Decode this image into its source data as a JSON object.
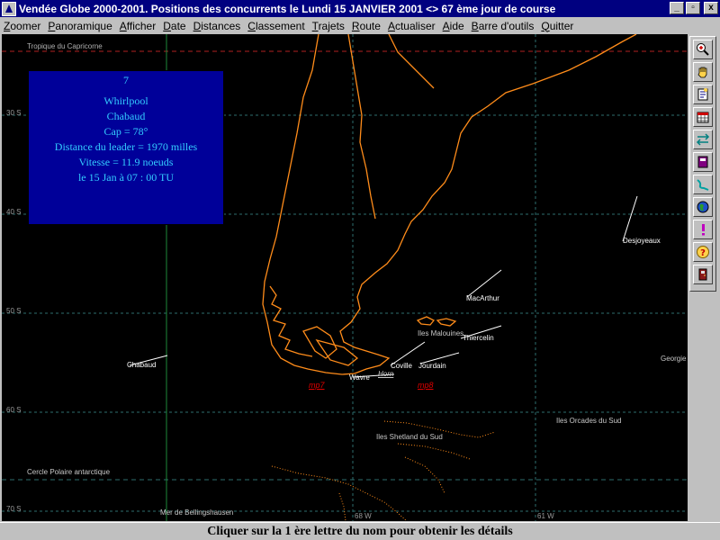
{
  "window": {
    "title": "Vendée Globe 2000-2001. Positions des concurrents le Lundi 15 JANVIER   2001 <> 67 ème jour de course",
    "minimize": "_",
    "maximize": "▫",
    "close": "x"
  },
  "menu": [
    {
      "ul": "Z",
      "rest": "oomer"
    },
    {
      "ul": "P",
      "rest": "anoramique"
    },
    {
      "ul": "A",
      "rest": "fficher"
    },
    {
      "ul": "D",
      "rest": "ate"
    },
    {
      "ul": "D",
      "rest": "istances"
    },
    {
      "ul": "C",
      "rest": "lassement"
    },
    {
      "ul": "T",
      "rest": "rajets"
    },
    {
      "ul": "R",
      "rest": "oute"
    },
    {
      "ul": "A",
      "rest": "ctualiser"
    },
    {
      "ul": "A",
      "rest": "ide"
    },
    {
      "ul": "B",
      "rest": "arre d'outils"
    },
    {
      "ul": "Q",
      "rest": "uitter"
    }
  ],
  "map": {
    "lat_labels": [
      "30 S",
      "40 S",
      "50 S",
      "60 S",
      "70 S"
    ],
    "lon_labels": [
      "68 W",
      "61 W"
    ],
    "places": {
      "tropique": "Tropique du Capricorne",
      "cercle_polaire": "Cercle Polaire antarctique",
      "malouines": "Iles Malouines",
      "georgie": "Georgie du Sud",
      "orcades": "Iles Orcades du Sud",
      "shetland": "Iles Shetland du Sud",
      "bellingshausen": "Mer de Bellingshausen",
      "horn": "Horn"
    },
    "racers": {
      "desjoyeaux": "Desjoyeaux",
      "macarthur": "MacArthur",
      "thiercelin": "Thiercelin",
      "chabaud": "Chabaud",
      "coville": "Coville",
      "jourdain": "Jourdain",
      "wavre": "Wavre"
    },
    "mp_markers": [
      "mp7",
      "mp8"
    ]
  },
  "info_box": {
    "rank": "7",
    "boat": "Whirlpool",
    "skipper": "Chabaud",
    "cap": "Cap =  78°",
    "distance": "Distance du leader = 1970 milles",
    "vitesse": "Vitesse =  11.9 noeuds",
    "date": "le 15 Jan à 07 : 00 TU"
  },
  "toolbar_tools": [
    "zoom-icon",
    "hand-pan-icon",
    "document-icon",
    "calendar-icon",
    "ruler-arrows-icon",
    "notebook-icon",
    "route-icon",
    "globe-icon",
    "exclamation-icon",
    "help-icon",
    "exit-door-icon"
  ],
  "status": "Cliquer sur la 1 ère lettre du nom pour obtenir les détails",
  "colors": {
    "title_bg": "#000080",
    "coast": "#ff8c1a",
    "info_bg": "#000099",
    "info_text": "#33ccff"
  }
}
